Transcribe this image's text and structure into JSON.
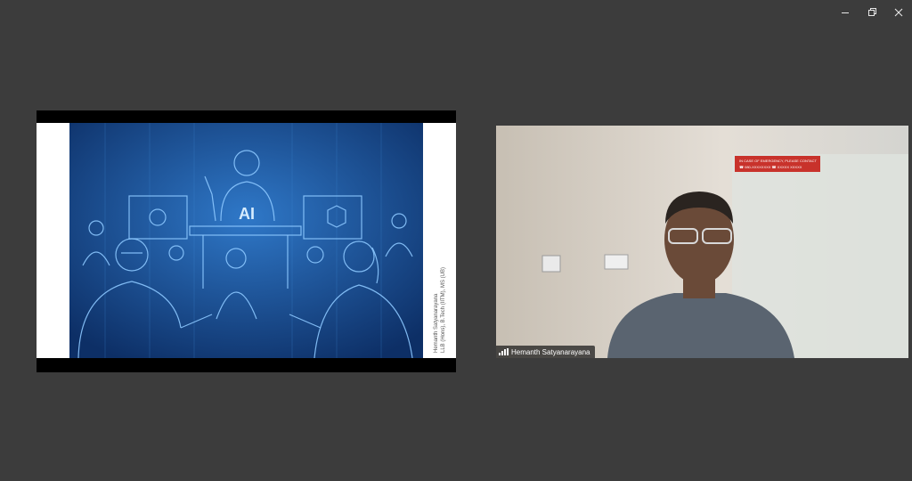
{
  "window": {
    "controls": [
      {
        "name": "minimize",
        "icon": "minimize-icon"
      },
      {
        "name": "restore",
        "icon": "restore-icon"
      },
      {
        "name": "close",
        "icon": "close-icon"
      }
    ]
  },
  "shared_screen": {
    "slide_text": "AI",
    "credit_line_1": "Hemanth Satyanarayana",
    "credit_line_2": "LLB (Hons), B.Tech (IITM), MS (UB)",
    "accent_color": "#1f5ea8"
  },
  "participant": {
    "name": "Hemanth Satyanarayana",
    "signal_icon": "signal-bars-icon",
    "wall_sign_line_1": "IN CASE OF EMERGENCY, PLEASE CONTACT",
    "wall_sign_line_2": "☎ 080-XXXXXXXX   ☎ XXXXX XXXXX",
    "wall_sign_color": "#c8322b"
  }
}
